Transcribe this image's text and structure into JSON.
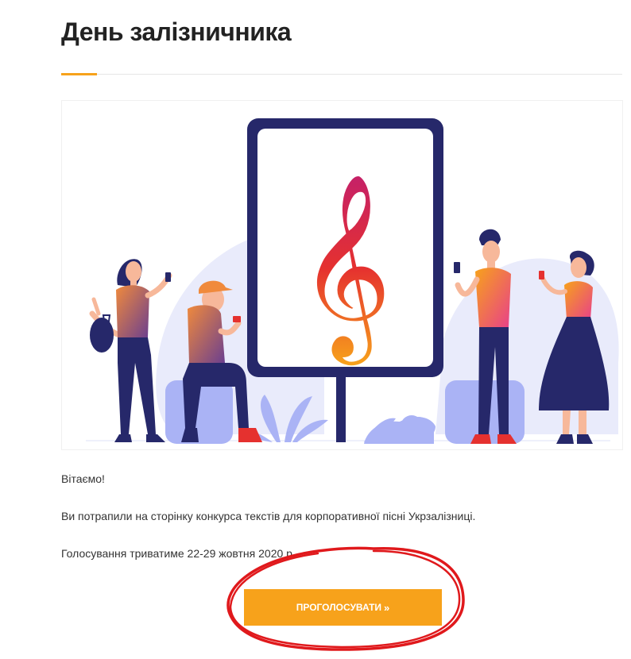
{
  "page": {
    "title": "День залізничника"
  },
  "hero": {
    "image": "people-with-phones-billboard-treble-clef-illustration",
    "colors": {
      "navy": "#26286a",
      "lavender": "#e9ebfb",
      "periwinkle": "#aab3f5",
      "orange": "#f7a21b",
      "red": "#e5312f",
      "magenta": "#c4206a"
    }
  },
  "content": {
    "greeting": "Вітаємо!",
    "intro": "Ви потрапили на сторінку конкурса текстів для корпоративної пісні Укрзалізниці.",
    "voting_period": "Голосування триватиме 22-29 жовтня 2020 р."
  },
  "vote": {
    "label": "ПРОГОЛОСУВАТИ",
    "icon": "double-chevron-right-icon",
    "color": "#f7a21b"
  },
  "annotation": {
    "shape": "hand-drawn-red-circle",
    "color": "#e0191c"
  }
}
